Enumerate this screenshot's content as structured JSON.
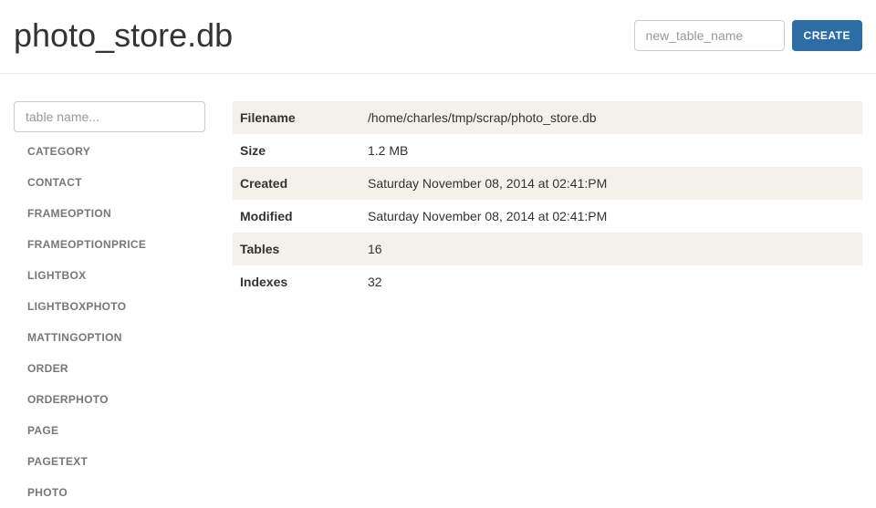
{
  "header": {
    "title": "photo_store.db",
    "new_table_placeholder": "new_table_name",
    "create_label": "CREATE"
  },
  "sidebar": {
    "filter_placeholder": "table name...",
    "items": [
      "CATEGORY",
      "CONTACT",
      "FRAMEOPTION",
      "FRAMEOPTIONPRICE",
      "LIGHTBOX",
      "LIGHTBOXPHOTO",
      "MATTINGOPTION",
      "ORDER",
      "ORDERPHOTO",
      "PAGE",
      "PAGETEXT",
      "PHOTO"
    ]
  },
  "info": {
    "rows": [
      {
        "label": "Filename",
        "value": "/home/charles/tmp/scrap/photo_store.db"
      },
      {
        "label": "Size",
        "value": "1.2 MB"
      },
      {
        "label": "Created",
        "value": "Saturday November 08, 2014 at 02:41:PM"
      },
      {
        "label": "Modified",
        "value": "Saturday November 08, 2014 at 02:41:PM"
      },
      {
        "label": "Tables",
        "value": "16"
      },
      {
        "label": "Indexes",
        "value": "32"
      }
    ]
  }
}
